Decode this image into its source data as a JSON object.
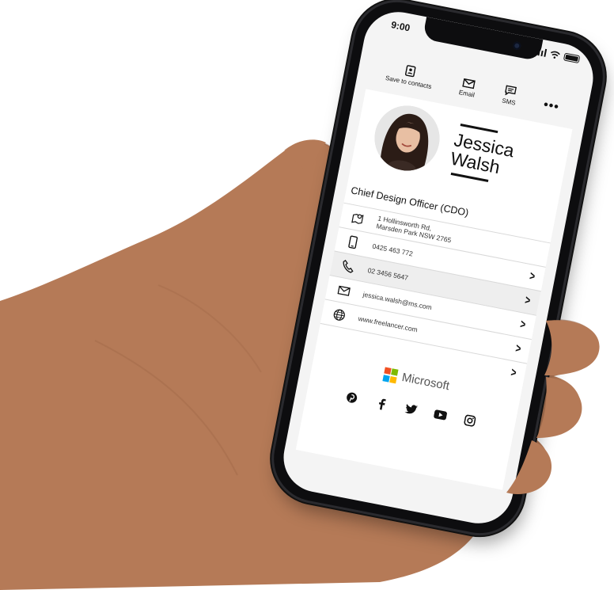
{
  "status": {
    "time": "9:00"
  },
  "actions": {
    "save_label": "Save to contacts",
    "email_label": "Email",
    "sms_label": "SMS",
    "more_label": "•••"
  },
  "profile": {
    "first_name": "Jessica",
    "last_name": "Walsh",
    "title": "Chief Design Officer (CDO)"
  },
  "contact": {
    "address_line1": "1 Hollinsworth Rd,",
    "address_line2": "Marsden Park NSW 2765",
    "mobile": "0425 463 772",
    "phone": "02 3456 5647",
    "email": "jessica.walsh@ms.com",
    "website": "www.freelancer.com",
    "chevron": ">"
  },
  "company": {
    "name": "Microsoft"
  },
  "social": [
    "pinterest-icon",
    "facebook-icon",
    "twitter-icon",
    "youtube-icon",
    "instagram-icon"
  ],
  "colors": {
    "ms_red": "#f25022",
    "ms_green": "#7fba00",
    "ms_blue": "#00a4ef",
    "ms_yellow": "#ffb900"
  }
}
